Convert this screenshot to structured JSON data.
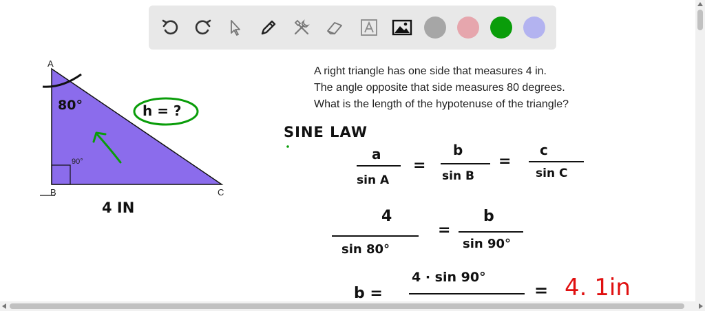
{
  "toolbar": {
    "tools": [
      {
        "name": "undo-icon"
      },
      {
        "name": "redo-icon"
      },
      {
        "name": "pointer-icon"
      },
      {
        "name": "pen-icon"
      },
      {
        "name": "tools-icon"
      },
      {
        "name": "eraser-icon"
      },
      {
        "name": "text-icon"
      },
      {
        "name": "image-icon"
      }
    ],
    "swatches": [
      {
        "name": "gray",
        "color": "#a6a6a6"
      },
      {
        "name": "pink",
        "color": "#e6a6ad"
      },
      {
        "name": "green",
        "color": "#0a9d0a"
      },
      {
        "name": "lavender",
        "color": "#b3b3f0"
      }
    ]
  },
  "problem": {
    "line1": "A right triangle has one side that measures 4 in.",
    "line2": "The angle opposite that side measures 80 degrees.",
    "line3": "What is the length of the hypotenuse of the triangle?"
  },
  "triangle": {
    "fill": "#8b6cec",
    "vertex_a": "A",
    "vertex_b": "B",
    "vertex_c": "C",
    "right_angle": "90°",
    "angle_a": "80°",
    "hypotenuse_note": "h = ?",
    "base_length": "4 IN"
  },
  "work": {
    "heading": "SINE LAW",
    "law_a_num": "a",
    "law_a_den": "sin A",
    "law_b_num": "b",
    "law_b_den": "sin B",
    "law_c_num": "c",
    "law_c_den": "sin C",
    "eq1": "=",
    "eq2": "=",
    "sub_num_left": "4",
    "sub_den_left": "sin 80°",
    "sub_eq": "=",
    "sub_num_right": "b",
    "sub_den_right": "sin 90°",
    "res_lhs": "b =",
    "res_num": "4 · sin 90°",
    "res_eq": "=",
    "result": "4. 1in",
    "result_color": "#e01010"
  }
}
